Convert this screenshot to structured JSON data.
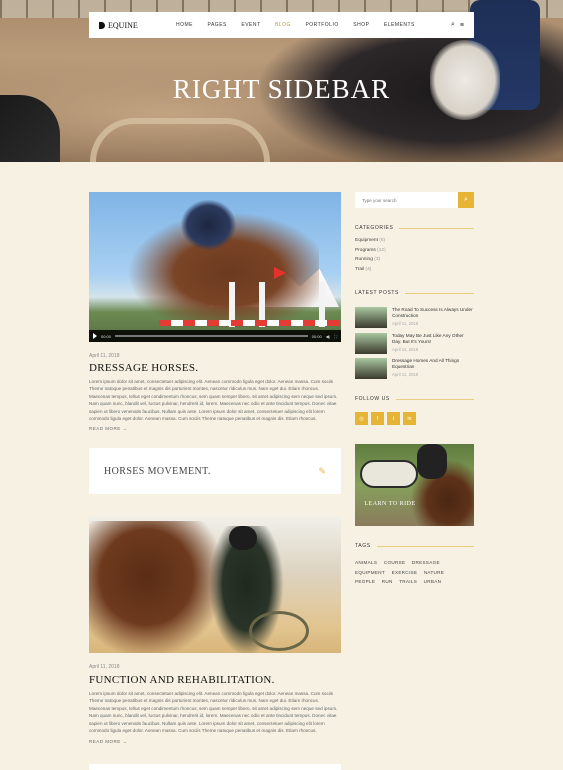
{
  "header": {
    "logo": "EQUINE",
    "nav": [
      "HOME",
      "PAGES",
      "EVENT",
      "BLOG",
      "PORTFOLIO",
      "SHOP",
      "ELEMENTS"
    ],
    "active_nav": "BLOG"
  },
  "hero": {
    "title": "RIGHT SIDEBAR"
  },
  "posts": [
    {
      "date": "April 11, 2018",
      "title": "DRESSAGE HORSES.",
      "excerpt": "Lorem ipsum dolor sit amet, consectetuer adipiscing elit. Aenean commodo ligula eget dolor. Aenean massa. Cum sociis Theme natoque penatibus et magnis dis parturient montes, nascetur ridiculus mus. Nam eget dui. Etiam rhoncus. Maecenas tempus, tellus eget condimentum rhoncus, sem quam semper libero, sit amet adipiscing sem neque sed ipsum. Nam quam nunc, blandit vel, luctus pulvinar, hendrerit id, lorem. Maecenas nec odio et ante tincidunt tempus. Donec vitae sapien ut libero venenatis faucibus. Nullam quis ante. Lorem ipsum dolor sit amet, consectetuer adipiscing elit lorem commodo ligula eget dolor. Aenean massa. Cum sociis Theme natoque penatibus et magnis dis. Etiam rhoncus.",
      "read_more": "READ MORE",
      "video_time_start": "00:00",
      "video_time_end": "00:00"
    },
    {
      "date": "April 11, 2018",
      "title": "FUNCTION AND REHABILITATION.",
      "excerpt": "Lorem ipsum dolor sit amet, consectetuer adipiscing elit. Aenean commodo ligula eget dolor. Aenean massa. Cum sociis Theme natoque penatibus et magnis dis parturient montes, nascetur ridiculus mus. Nam eget dui. Etiam rhoncus. Maecenas tempus, tellus eget condimentum rhoncus, sem quam semper libero, sit amet adipiscing sem neque sed ipsum. Nam quam nunc, blandit vel, luctus pulvinar, hendrerit id, lorem. Maecenas nec odio et ante tincidunt tempus. Donec vitae sapien ut libero venenatis faucibus. Nullam quis ante. Lorem ipsum dolor sit amet, consectetuer adipiscing elit lorem commodo ligula eget dolor. Aenean massa. Cum sociis Theme natoque penatibus et magnis dis. Etiam rhoncus.",
      "read_more": "READ MORE"
    }
  ],
  "quote": {
    "text": "HORSES MOVEMENT."
  },
  "sidebar": {
    "search_placeholder": "Type your search",
    "categories_title": "CATEGORIES",
    "categories": [
      {
        "name": "Equipment",
        "count": "(6)"
      },
      {
        "name": "Programs",
        "count": "(12)"
      },
      {
        "name": "Running",
        "count": "(3)"
      },
      {
        "name": "Trail",
        "count": "(4)"
      }
    ],
    "latest_title": "LATEST POSTS",
    "latest": [
      {
        "title": "The Road To Success Is Always Under Construction",
        "date": "April 11, 2018"
      },
      {
        "title": "Today May Be Just Like Any Other Day. But It's Yours!",
        "date": "April 11, 2018"
      },
      {
        "title": "Dressage Horses And All Things Equestrian",
        "date": "April 11, 2018"
      }
    ],
    "follow_title": "FOLLOW US",
    "socials": [
      "instagram-icon",
      "facebook-icon",
      "twitter-icon",
      "linkedin-icon"
    ],
    "banner_text": "LEARN TO RIDE",
    "tags_title": "TAGS",
    "tags": [
      "ANIMALS",
      "COURSE",
      "DRESSAGE",
      "EQUIPMENT",
      "EXERCISE",
      "NATURE",
      "PEOPLE",
      "RUN",
      "TRAILS",
      "URBAN"
    ]
  },
  "colors": {
    "accent": "#e6b536",
    "background": "#f6f1e3"
  }
}
